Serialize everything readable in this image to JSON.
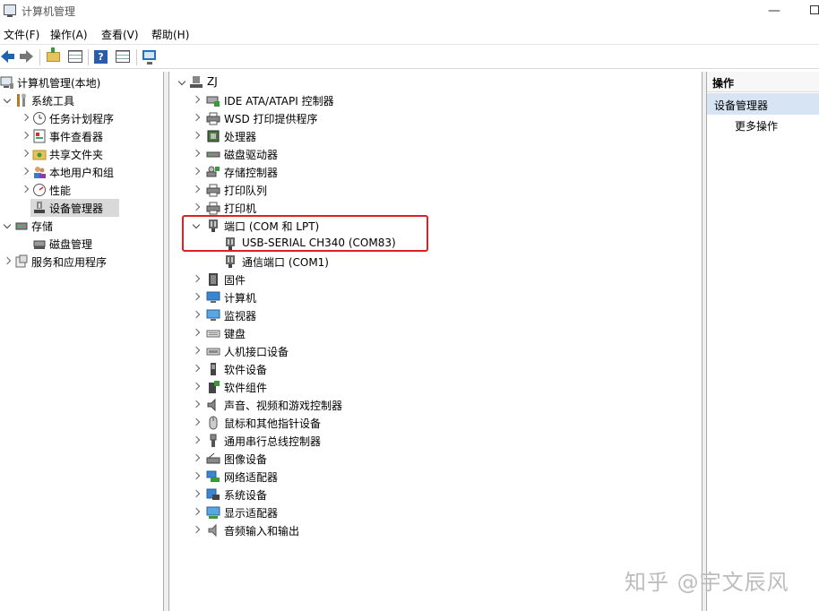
{
  "window": {
    "title": "计算机管理"
  },
  "menu": [
    "文件(F)",
    "操作(A)",
    "查看(V)",
    "帮助(H)"
  ],
  "left_tree": [
    {
      "label": "计算机管理(本地)",
      "icon": "computer-management-icon",
      "level": 0,
      "twisty": "none"
    },
    {
      "label": "系统工具",
      "icon": "system-tools-icon",
      "level": 1,
      "twisty": "expanded"
    },
    {
      "label": "任务计划程序",
      "icon": "task-scheduler-icon",
      "level": 2,
      "twisty": "collapsed"
    },
    {
      "label": "事件查看器",
      "icon": "event-viewer-icon",
      "level": 2,
      "twisty": "collapsed"
    },
    {
      "label": "共享文件夹",
      "icon": "shared-folders-icon",
      "level": 2,
      "twisty": "collapsed"
    },
    {
      "label": "本地用户和组",
      "icon": "local-users-icon",
      "level": 2,
      "twisty": "collapsed"
    },
    {
      "label": "性能",
      "icon": "performance-icon",
      "level": 2,
      "twisty": "collapsed"
    },
    {
      "label": "设备管理器",
      "icon": "device-manager-icon",
      "level": 2,
      "twisty": "none",
      "selected": true
    },
    {
      "label": "存储",
      "icon": "storage-icon",
      "level": 1,
      "twisty": "expanded"
    },
    {
      "label": "磁盘管理",
      "icon": "disk-management-icon",
      "level": 2,
      "twisty": "none"
    },
    {
      "label": "服务和应用程序",
      "icon": "services-apps-icon",
      "level": 1,
      "twisty": "collapsed"
    }
  ],
  "device_tree": {
    "root": "ZJ",
    "items": [
      {
        "label": "IDE ATA/ATAPI 控制器",
        "icon": "ide-controller-icon",
        "expanded": false
      },
      {
        "label": "WSD 打印提供程序",
        "icon": "printer-icon",
        "expanded": false
      },
      {
        "label": "处理器",
        "icon": "processor-icon",
        "expanded": false
      },
      {
        "label": "磁盘驱动器",
        "icon": "disk-drive-icon",
        "expanded": false
      },
      {
        "label": "存储控制器",
        "icon": "storage-controller-icon",
        "expanded": false
      },
      {
        "label": "打印队列",
        "icon": "print-queue-icon",
        "expanded": false
      },
      {
        "label": "打印机",
        "icon": "printer-icon",
        "expanded": false
      },
      {
        "label": "端口 (COM 和 LPT)",
        "icon": "port-icon",
        "expanded": true,
        "children": [
          "USB-SERIAL CH340 (COM83)",
          "通信端口 (COM1)"
        ]
      },
      {
        "label": "固件",
        "icon": "firmware-icon",
        "expanded": false
      },
      {
        "label": "计算机",
        "icon": "computer-icon",
        "expanded": false
      },
      {
        "label": "监视器",
        "icon": "monitor-icon",
        "expanded": false
      },
      {
        "label": "键盘",
        "icon": "keyboard-icon",
        "expanded": false
      },
      {
        "label": "人机接口设备",
        "icon": "hid-icon",
        "expanded": false
      },
      {
        "label": "软件设备",
        "icon": "software-device-icon",
        "expanded": false
      },
      {
        "label": "软件组件",
        "icon": "software-component-icon",
        "expanded": false
      },
      {
        "label": "声音、视频和游戏控制器",
        "icon": "sound-icon",
        "expanded": false
      },
      {
        "label": "鼠标和其他指针设备",
        "icon": "mouse-icon",
        "expanded": false
      },
      {
        "label": "通用串行总线控制器",
        "icon": "usb-icon",
        "expanded": false
      },
      {
        "label": "图像设备",
        "icon": "imaging-device-icon",
        "expanded": false
      },
      {
        "label": "网络适配器",
        "icon": "network-adapter-icon",
        "expanded": false
      },
      {
        "label": "系统设备",
        "icon": "system-device-icon",
        "expanded": false
      },
      {
        "label": "显示适配器",
        "icon": "display-adapter-icon",
        "expanded": false
      },
      {
        "label": "音频输入和输出",
        "icon": "audio-io-icon",
        "expanded": false
      }
    ]
  },
  "actions": {
    "header": "操作",
    "section": "设备管理器",
    "more": "更多操作"
  },
  "watermark": "知乎 @宇文辰风",
  "colors": {
    "highlight_border": "#e02020",
    "selection": "#d9d9d9",
    "actions_section": "#d6e4f3"
  }
}
